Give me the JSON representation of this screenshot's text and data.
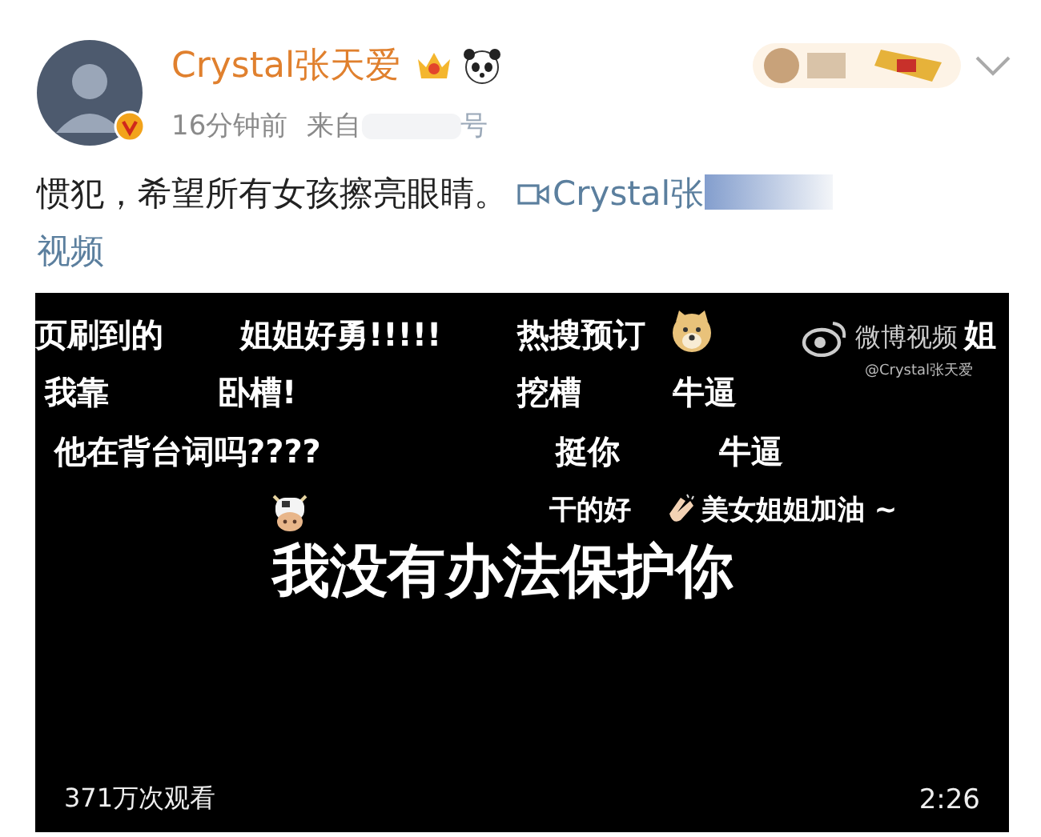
{
  "post": {
    "author": {
      "name": "Crystal张天爱",
      "verified": true
    },
    "time": "16分钟前",
    "source_prefix": "来自",
    "source_suffix": "号",
    "text": "惯犯，希望所有女孩擦亮眼睛。",
    "link": "Crystal张",
    "link_tail": "视频"
  },
  "video": {
    "watermark": {
      "brand": "微博视频",
      "handle": "@Crystal张天爱"
    },
    "danmaku": [
      {
        "kind": "text",
        "text": "页刷到的"
      },
      {
        "kind": "text",
        "text": "姐姐好勇!!!!!"
      },
      {
        "kind": "text",
        "text": "热搜预订"
      },
      {
        "kind": "dog"
      },
      {
        "kind": "text",
        "text": "姐"
      },
      {
        "kind": "text",
        "text": "我靠"
      },
      {
        "kind": "text",
        "text": "卧槽!"
      },
      {
        "kind": "text",
        "text": "挖槽"
      },
      {
        "kind": "text",
        "text": "牛逼"
      },
      {
        "kind": "text",
        "text": "他在背台词吗????"
      },
      {
        "kind": "text",
        "text": "挺你"
      },
      {
        "kind": "text",
        "text": "牛逼"
      },
      {
        "kind": "cow"
      },
      {
        "kind": "text",
        "text": "干的好"
      },
      {
        "kind": "clap"
      },
      {
        "kind": "text",
        "text": "美女姐姐加油 ~"
      }
    ],
    "subtitle": "我没有办法保护你",
    "views": "371万次观看",
    "duration": "2:26"
  }
}
